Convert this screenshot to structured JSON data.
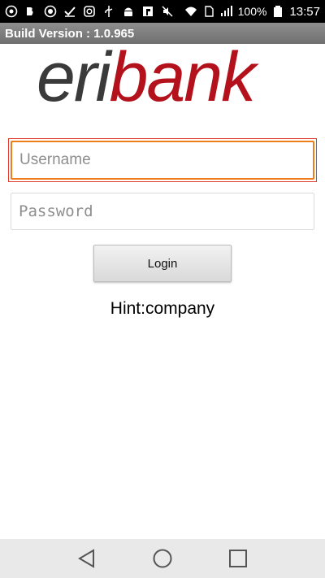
{
  "status_bar": {
    "battery_percent": "100%",
    "time": "13:57",
    "icons": [
      "app-circle-icon",
      "app-b-icon",
      "app-eye-icon",
      "check-mail-icon",
      "instagram-icon",
      "usb-icon",
      "android-icon",
      "flipboard-icon",
      "mute-icon",
      "wifi-icon",
      "sim-icon",
      "signal-icon",
      "battery-icon"
    ]
  },
  "build": {
    "label": "Build Version : 1.0.965"
  },
  "logo": {
    "part1": "eri",
    "part2": "bank",
    "colors": {
      "eri": "#3a3a3a",
      "bank": "#b3121c"
    }
  },
  "form": {
    "username_placeholder": "Username",
    "username_value": "",
    "password_placeholder": "Password",
    "password_value": "",
    "login_label": "Login",
    "hint": "Hint:company"
  },
  "colors": {
    "focus_outer": "#e03a2a",
    "focus_inner": "#f07d1c"
  },
  "nav_bar": {
    "buttons": [
      "back-icon",
      "home-icon",
      "recents-icon"
    ]
  }
}
